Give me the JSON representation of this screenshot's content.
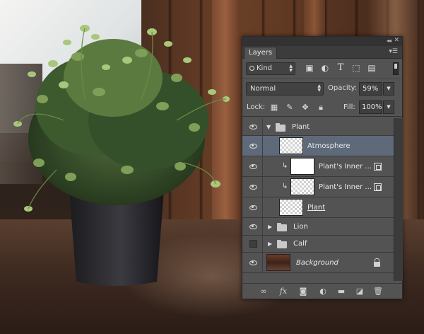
{
  "panel": {
    "tab_label": "Layers",
    "filter": {
      "kind_label": "Kind"
    },
    "blend_mode": "Normal",
    "opacity_label": "Opacity:",
    "opacity_value": "59%",
    "lock_label": "Lock:",
    "fill_label": "Fill:",
    "fill_value": "100%"
  },
  "layers": [
    {
      "name": "Plant",
      "type": "group",
      "visible": true,
      "expanded": true
    },
    {
      "name": "Atmosphere",
      "type": "layer",
      "visible": true,
      "selected": true
    },
    {
      "name": "Plant's Inner ...",
      "type": "clipped",
      "visible": true,
      "has_fx": true
    },
    {
      "name": "Plant's Inner ...",
      "type": "clipped",
      "visible": true,
      "has_fx": true
    },
    {
      "name": "Plant",
      "type": "smart-object",
      "visible": true
    },
    {
      "name": "Lion",
      "type": "group",
      "visible": true,
      "expanded": false
    },
    {
      "name": "Calf",
      "type": "group",
      "visible": false,
      "expanded": false
    },
    {
      "name": "Background",
      "type": "background",
      "visible": true,
      "locked": true
    }
  ],
  "colors": {
    "panel_bg": "#535353",
    "selected_row": "#5e6a7a",
    "titlebar": "#323232"
  },
  "icons": {
    "filter_icons": [
      "image-filter-icon",
      "adjustment-filter-icon",
      "type-filter-icon",
      "shape-filter-icon",
      "smart-object-filter-icon"
    ],
    "lock_icons": [
      "lock-transparent-icon",
      "lock-image-icon",
      "lock-position-icon",
      "lock-all-icon"
    ],
    "bottom_icons": [
      "link-layers-icon",
      "fx-icon",
      "add-mask-icon",
      "adjustment-layer-icon",
      "new-group-icon",
      "new-layer-icon",
      "trash-icon"
    ]
  }
}
